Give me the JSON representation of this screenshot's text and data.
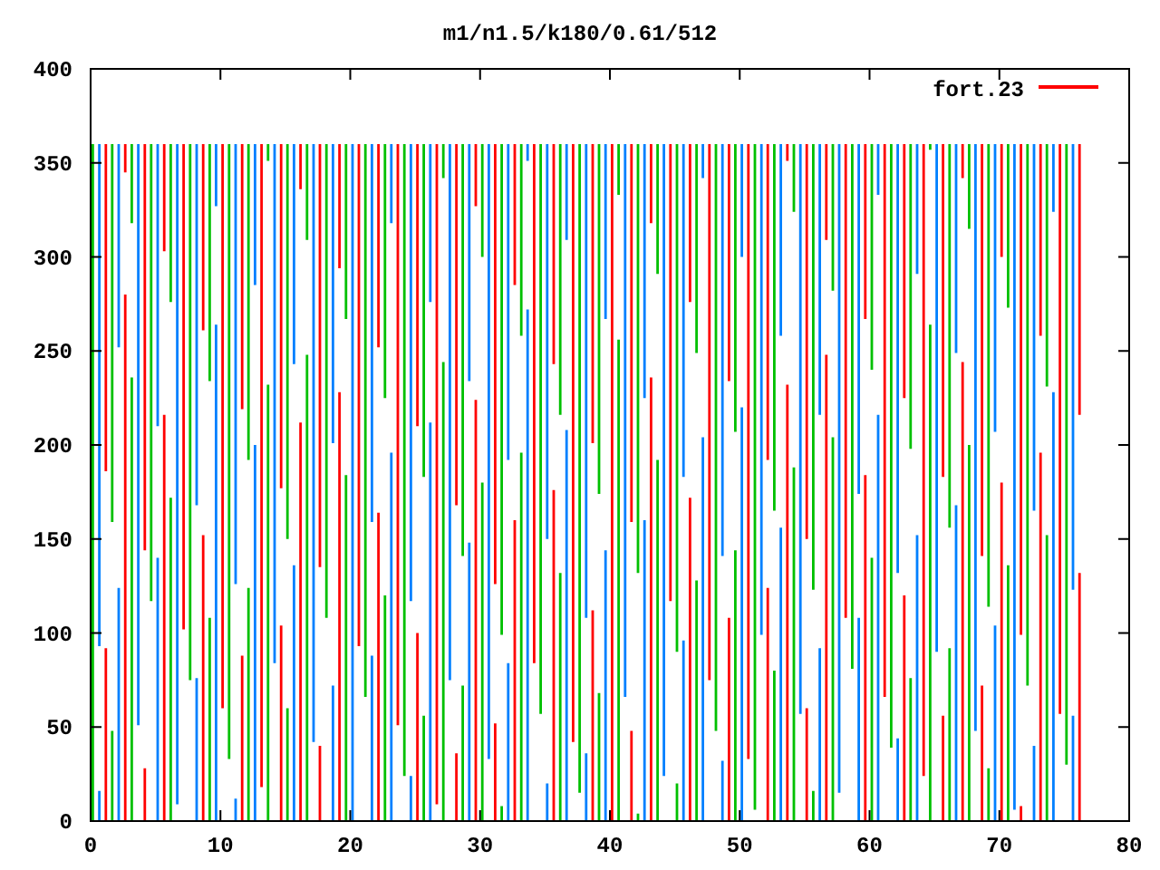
{
  "plot": {
    "title": "m1/n1.5/k180/0.61/512",
    "y_ticks": [
      "400",
      "350",
      "300",
      "250",
      "200",
      "150",
      "100",
      "50",
      "0"
    ],
    "x_ticks": [
      "0",
      "10",
      "20",
      "30",
      "40",
      "50",
      "60",
      "70",
      "80"
    ],
    "legend": {
      "label": "fort.23",
      "color": "#ff0000"
    }
  }
}
